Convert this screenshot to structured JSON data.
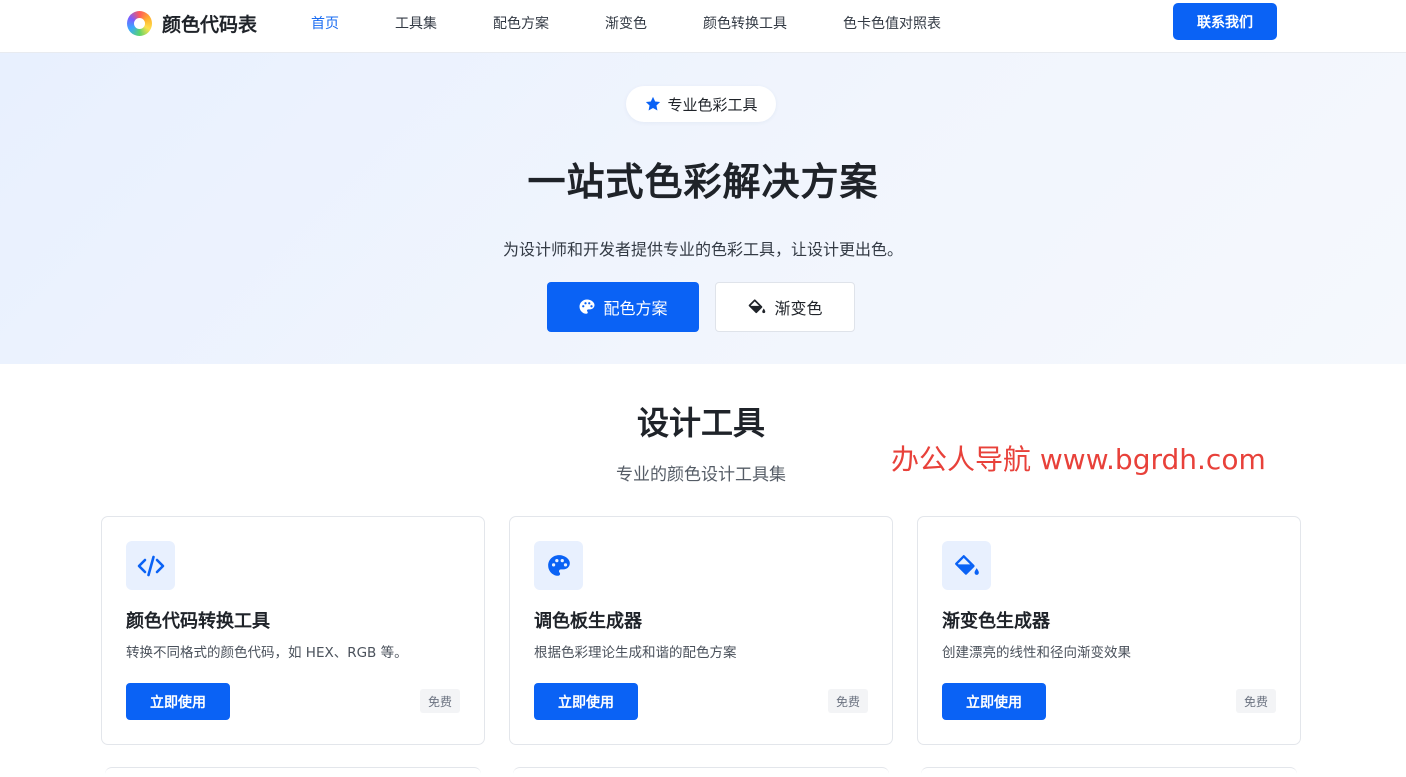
{
  "brand": {
    "name": "颜色代码表"
  },
  "nav": {
    "items": [
      {
        "label": "首页",
        "active": true
      },
      {
        "label": "工具集",
        "active": false
      },
      {
        "label": "配色方案",
        "active": false
      },
      {
        "label": "渐变色",
        "active": false
      },
      {
        "label": "颜色转换工具",
        "active": false
      },
      {
        "label": "色卡色值对照表",
        "active": false
      }
    ],
    "contact_label": "联系我们"
  },
  "hero": {
    "badge": "专业色彩工具",
    "title": "一站式色彩解决方案",
    "subtitle": "为设计师和开发者提供专业的色彩工具，让设计更出色。",
    "primary_button": "配色方案",
    "secondary_button": "渐变色"
  },
  "section": {
    "title": "设计工具",
    "subtitle": "专业的颜色设计工具集"
  },
  "watermark": "办公人导航 www.bgrdh.com",
  "cards": [
    {
      "icon": "code-icon",
      "title": "颜色代码转换工具",
      "desc": "转换不同格式的颜色代码，如 HEX、RGB 等。",
      "button": "立即使用",
      "badge": "免费"
    },
    {
      "icon": "palette-icon",
      "title": "调色板生成器",
      "desc": "根据色彩理论生成和谐的配色方案",
      "button": "立即使用",
      "badge": "免费"
    },
    {
      "icon": "fill-bucket-icon",
      "title": "渐变色生成器",
      "desc": "创建漂亮的线性和径向渐变效果",
      "button": "立即使用",
      "badge": "免费"
    }
  ],
  "colors": {
    "accent": "#0a62f5",
    "hero_bg": "#eef3fd",
    "watermark": "#e8413a"
  }
}
